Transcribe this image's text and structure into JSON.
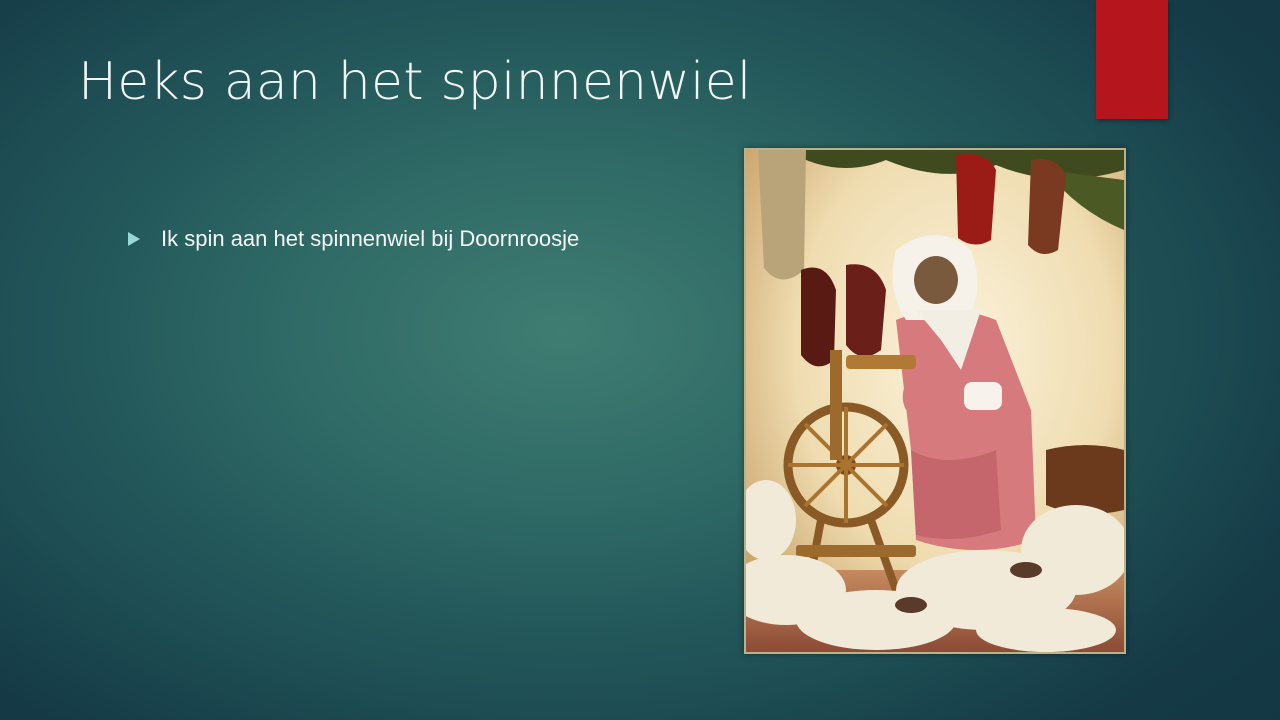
{
  "slide": {
    "title": "Heks aan het spinnenwiel",
    "bullets": [
      "Ik spin aan het spinnenwiel bij Doornroosje"
    ],
    "accent_color": "#b5151c",
    "bullet_color": "#9ad6d4",
    "background_color": "#2f6a66"
  },
  "image": {
    "description_icon": "witch-spinning-wheel-photo"
  }
}
